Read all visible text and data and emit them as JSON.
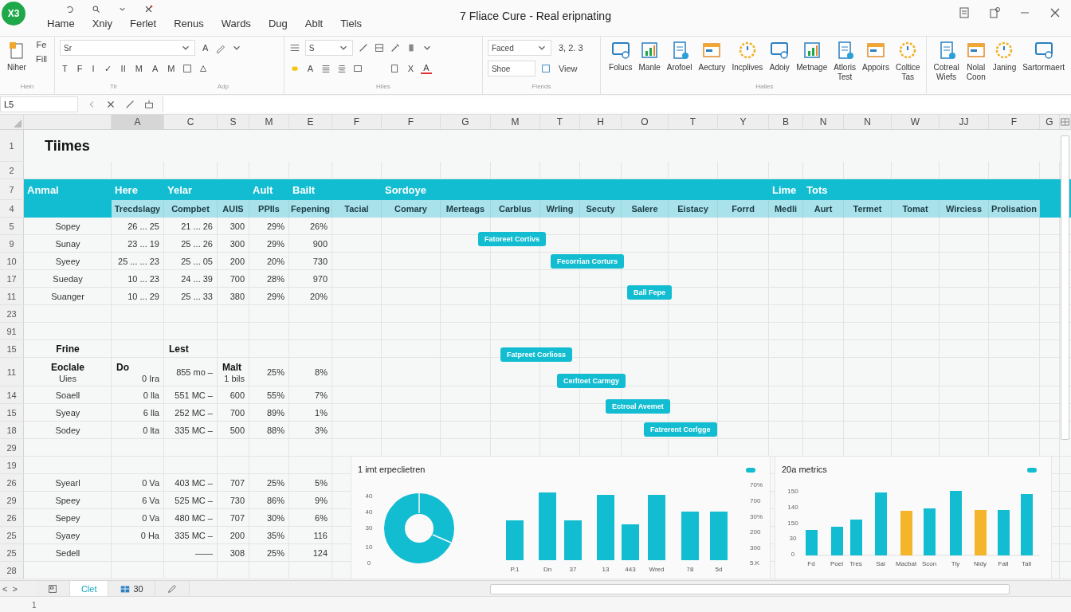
{
  "window": {
    "logo": "X3",
    "title": "7 Fliace Cure - Real eripnating"
  },
  "menu_tabs": [
    "Hame",
    "Xniy",
    "Ferlet",
    "Renus",
    "Wards",
    "Dug",
    "Ablt",
    "Tiels"
  ],
  "ribbon": {
    "clipboard": {
      "paste": "Niher",
      "small_buttons": [
        "Fe",
        "Fill"
      ],
      "group_label": "Hein"
    },
    "font": {
      "font_name": "Sr",
      "grow_button": "A",
      "format_buttons": [
        "T",
        "F",
        "I",
        "✓",
        "II",
        "M",
        "A",
        "M"
      ],
      "group_labels": [
        "Tir",
        "Adp"
      ]
    },
    "alignment": {
      "style_field": "S",
      "color_button": "A",
      "clear_button": "X",
      "font_color_button": "A",
      "group_label": "Hiles"
    },
    "number": {
      "format_field": "Faced",
      "style_field": "Shoe",
      "number_buttons": "3, 2. 3",
      "view_button": "View",
      "group_label": "Flends"
    },
    "commands": {
      "buttons": [
        "Folucs",
        "Manle",
        "Arofoel",
        "Aectury",
        "Incplives",
        "Adoiy",
        "Metnage",
        "Atloris Test",
        "Appoirs",
        "Coltice Tas"
      ],
      "group_label": "Halles"
    },
    "extras": {
      "buttons": [
        "Cotreal Wiefs",
        "Nolal Coon",
        "Janing",
        "Sartormaert"
      ]
    }
  },
  "formula_bar": {
    "name_box": "L5"
  },
  "column_letters": [
    {
      "letter": "A",
      "selected": true
    },
    {
      "letter": "C",
      "selected": false
    },
    {
      "letter": "S",
      "selected": false
    },
    {
      "letter": "M",
      "selected": false
    },
    {
      "letter": "E",
      "selected": false
    },
    {
      "letter": "F",
      "selected": false
    },
    {
      "letter": "F",
      "selected": false
    },
    {
      "letter": "G",
      "selected": false
    },
    {
      "letter": "M",
      "selected": false
    },
    {
      "letter": "T",
      "selected": false
    },
    {
      "letter": "H",
      "selected": false
    },
    {
      "letter": "O",
      "selected": false
    },
    {
      "letter": "T",
      "selected": false
    },
    {
      "letter": "Y",
      "selected": false
    },
    {
      "letter": "B",
      "selected": false
    },
    {
      "letter": "N",
      "selected": false
    },
    {
      "letter": "N",
      "selected": false
    },
    {
      "letter": "W",
      "selected": false
    },
    {
      "letter": "JJ",
      "selected": false
    },
    {
      "letter": "F",
      "selected": false
    },
    {
      "letter": "G",
      "selected": false
    }
  ],
  "rows": [
    {
      "number": "1",
      "kind": "title",
      "column_1": "Tiimes"
    },
    {
      "number": "2",
      "kind": "blank"
    },
    {
      "number": "7",
      "kind": "band",
      "column_1": "Anmal",
      "column_2": "Here",
      "column_3": "Yelar",
      "column_5": "Ault",
      "column_6": "Bailt",
      "column_8": "Sordoye",
      "column_16": "Lime",
      "column_17": "Tots"
    },
    {
      "number": "4",
      "kind": "subheader",
      "column_2": "Trecdslagy",
      "column_3": "Compbet",
      "column_4": "AUIS",
      "column_5": "PPIls",
      "column_6": "Fepening",
      "column_7": "Tacial",
      "column_8": "Comary",
      "column_9": "Merteags",
      "column_10": "Carblus",
      "column_11": "Wrling",
      "column_12": "Secuty",
      "column_13": "Salere",
      "column_14": "Eistacy",
      "column_15": "Forrd",
      "column_16": "Medli",
      "column_17": "Aurt",
      "column_18": "Termet",
      "column_19": "Tomat",
      "column_20": "Wirciess",
      "column_21": "Prolisation"
    },
    {
      "number": "5",
      "kind": "data",
      "column_1": "Sopey",
      "column_2": "26 ... 25",
      "column_3": "21 ... 26",
      "column_4": "300",
      "column_5": "29%",
      "column_6": "26%"
    },
    {
      "number": "9",
      "kind": "data",
      "column_1": "Sunay",
      "column_2": "23 ... 19",
      "column_3": "25 ... 26",
      "column_4": "300",
      "column_5": "29%",
      "column_6": "900"
    },
    {
      "number": "10",
      "kind": "data",
      "column_1": "Syeey",
      "column_2": "25 ... ... 23",
      "column_3": "25 ... 05",
      "column_4": "200",
      "column_5": "20%",
      "column_6": "730"
    },
    {
      "number": "17",
      "kind": "data",
      "column_1": "Sueday",
      "column_2": "10 ... 23",
      "column_3": "24 ... 39",
      "column_4": "700",
      "column_5": "28%",
      "column_6": "970"
    },
    {
      "number": "11",
      "kind": "data",
      "column_1": "Suanger",
      "column_2": "10 ... 29",
      "column_3": "25 ... 33",
      "column_4": "380",
      "column_5": "29%",
      "column_6": "20%"
    },
    {
      "number": "23",
      "kind": "blank"
    },
    {
      "number": "91",
      "kind": "blank"
    },
    {
      "number": "15",
      "kind": "heading",
      "column_1": "Frine",
      "column_3": "Lest"
    },
    {
      "number": "11",
      "kind": "split",
      "column_1": {
        "heading": "Eoclale",
        "value": "Uies"
      },
      "column_2": {
        "heading": "Do",
        "value": "0 Ira"
      },
      "column_3": "855 mo –",
      "column_4": {
        "heading": "Malt",
        "value": "1 bils"
      },
      "column_5": "25%",
      "column_6": "8%"
    },
    {
      "number": "14",
      "kind": "data",
      "column_1": "Soaell",
      "column_2": "0 lla",
      "column_3": "551 MC –",
      "column_4": "600",
      "column_5": "55%",
      "column_6": "7%"
    },
    {
      "number": "15",
      "kind": "data",
      "column_1": "Syeay",
      "column_2": "6 lla",
      "column_3": "252 MC –",
      "column_4": "700",
      "column_5": "89%",
      "column_6": "1%"
    },
    {
      "number": "18",
      "kind": "data",
      "column_1": "Sodey",
      "column_2": "0 lta",
      "column_3": "335 MC –",
      "column_4": "500",
      "column_5": "88%",
      "column_6": "3%"
    },
    {
      "number": "29",
      "kind": "blank"
    },
    {
      "number": "19",
      "kind": "blank"
    },
    {
      "number": "26",
      "kind": "data",
      "column_1": "Syearl",
      "column_2": "0 Va",
      "column_3": "403 MC –",
      "column_4": "707",
      "column_5": "25%",
      "column_6": "5%"
    },
    {
      "number": "29",
      "kind": "data",
      "column_1": "Speey",
      "column_2": "6 Va",
      "column_3": "525 MC –",
      "column_4": "730",
      "column_5": "86%",
      "column_6": "9%"
    },
    {
      "number": "26",
      "kind": "data",
      "column_1": "Sepey",
      "column_2": "0 Va",
      "column_3": "480 MC –",
      "column_4": "707",
      "column_5": "30%",
      "column_6": "6%"
    },
    {
      "number": "25",
      "kind": "data",
      "column_1": "Syaey",
      "column_2": "0 Ha",
      "column_3": "335 MC –",
      "column_4": "200",
      "column_5": "35%",
      "column_6": "116"
    },
    {
      "number": "25",
      "kind": "data",
      "column_1": "Sedell",
      "column_3": "——",
      "column_4": "308",
      "column_5": "25%",
      "column_6": "124"
    },
    {
      "number": "28",
      "kind": "blank"
    }
  ],
  "tags": [
    "Fatoreet Cortivs",
    "Fecorrian Corturs",
    "Ball Fepe",
    "Fatpreet Corlioss",
    "Cerltoet Carmgy",
    "Ectroal Avemet",
    "Fatrerent Corlgge"
  ],
  "charts": [
    {
      "kind": "donut_bars",
      "title": "1 imt erpeclietren",
      "left_ticks": [
        "40",
        "40",
        "30",
        "10",
        "0"
      ],
      "categories": [
        "P.1",
        "Dn",
        "37",
        "13",
        "443",
        "Wred",
        "78",
        "5d"
      ],
      "right_ticks": [
        "70%",
        "700",
        "30%",
        "200",
        "300",
        "5.K"
      ]
    },
    {
      "kind": "bars",
      "title": "20a metrics",
      "left_ticks": [
        "150",
        "140",
        "150",
        "30",
        "0"
      ],
      "categories": [
        "Fd",
        "Poel",
        "Tres",
        "Sal",
        "Macbat",
        "Scon",
        "Tly",
        "Nidy",
        "Fall",
        "Tall"
      ]
    }
  ],
  "sheet_nav": [
    "<",
    ">"
  ],
  "sheet_tabs": [
    {
      "label": "Clet",
      "selected": true
    },
    {
      "label": "30",
      "selected": false
    }
  ],
  "status_bar": {
    "page": "1"
  }
}
